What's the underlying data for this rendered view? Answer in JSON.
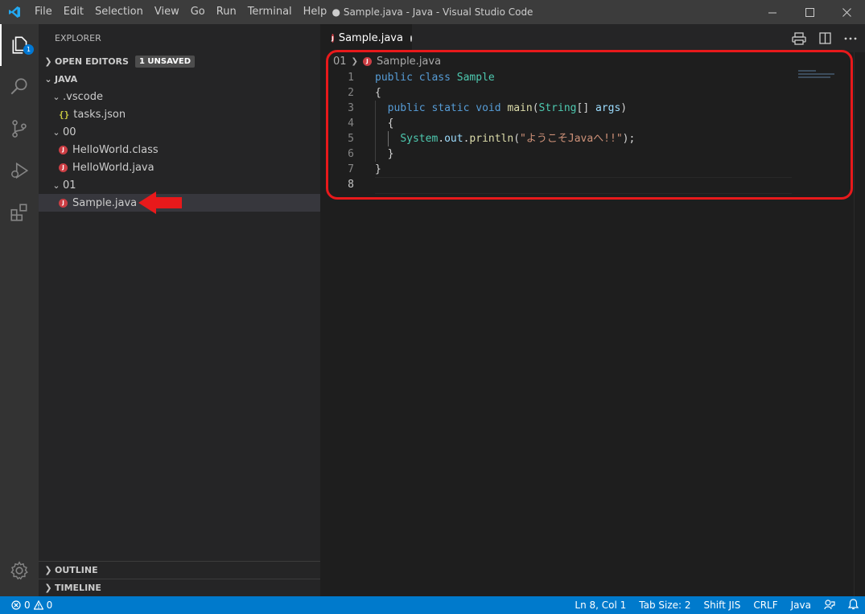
{
  "titlebar": {
    "menu": [
      "File",
      "Edit",
      "Selection",
      "View",
      "Go",
      "Run",
      "Terminal",
      "Help"
    ],
    "window_title": "● Sample.java - Java - Visual Studio Code"
  },
  "activitybar": {
    "explorer_badge": "1"
  },
  "sidebar": {
    "title": "EXPLORER",
    "open_editors": {
      "label": "OPEN EDITORS",
      "badge": "1 UNSAVED"
    },
    "workspace": {
      "label": "JAVA"
    },
    "tree": [
      {
        "label": ".vscode",
        "type": "folder"
      },
      {
        "label": "tasks.json",
        "type": "json"
      },
      {
        "label": "00",
        "type": "folder"
      },
      {
        "label": "HelloWorld.class",
        "type": "java"
      },
      {
        "label": "HelloWorld.java",
        "type": "java"
      },
      {
        "label": "01",
        "type": "folder"
      },
      {
        "label": "Sample.java",
        "type": "java",
        "selected": true
      }
    ],
    "outline_label": "OUTLINE",
    "timeline_label": "TIMELINE"
  },
  "editor": {
    "tab": {
      "label": "Sample.java",
      "dirty": true
    },
    "breadcrumb": {
      "folder": "01",
      "file": "Sample.java"
    },
    "line_numbers": [
      "1",
      "2",
      "3",
      "4",
      "5",
      "6",
      "7",
      "8"
    ],
    "code": {
      "l1_kw1": "public",
      "l1_kw2": "class",
      "l1_cls": "Sample",
      "l2": "{",
      "l3_kw1": "public",
      "l3_kw2": "static",
      "l3_kw3": "void",
      "l3_fn": "main",
      "l3_open": "(",
      "l3_type": "String",
      "l3_arr": "[] ",
      "l3_arg": "args",
      "l3_close": ")",
      "l4": "{",
      "l5_cls": "System",
      "l5_dot1": ".",
      "l5_field": "out",
      "l5_dot2": ".",
      "l5_fn": "println",
      "l5_open": "(",
      "l5_str": "\"ようこそJavaへ!!\"",
      "l5_close": ");",
      "l6": "}",
      "l7": "}"
    }
  },
  "statusbar": {
    "errors": "0",
    "warnings": "0",
    "position": "Ln 8, Col 1",
    "tab_size": "Tab Size: 2",
    "encoding": "Shift JIS",
    "eol": "CRLF",
    "language": "Java"
  },
  "colors": {
    "statusbar": "#007acc",
    "annotation": "#e8191b",
    "java_icon": "#cc3e44"
  },
  "icons": [
    "vscode-logo-icon",
    "explorer-icon",
    "search-icon",
    "source-control-icon",
    "run-debug-icon",
    "extensions-icon",
    "settings-gear-icon",
    "print-icon",
    "split-editor-icon",
    "more-actions-icon",
    "error-icon",
    "warning-icon",
    "feedback-icon",
    "bell-icon"
  ]
}
